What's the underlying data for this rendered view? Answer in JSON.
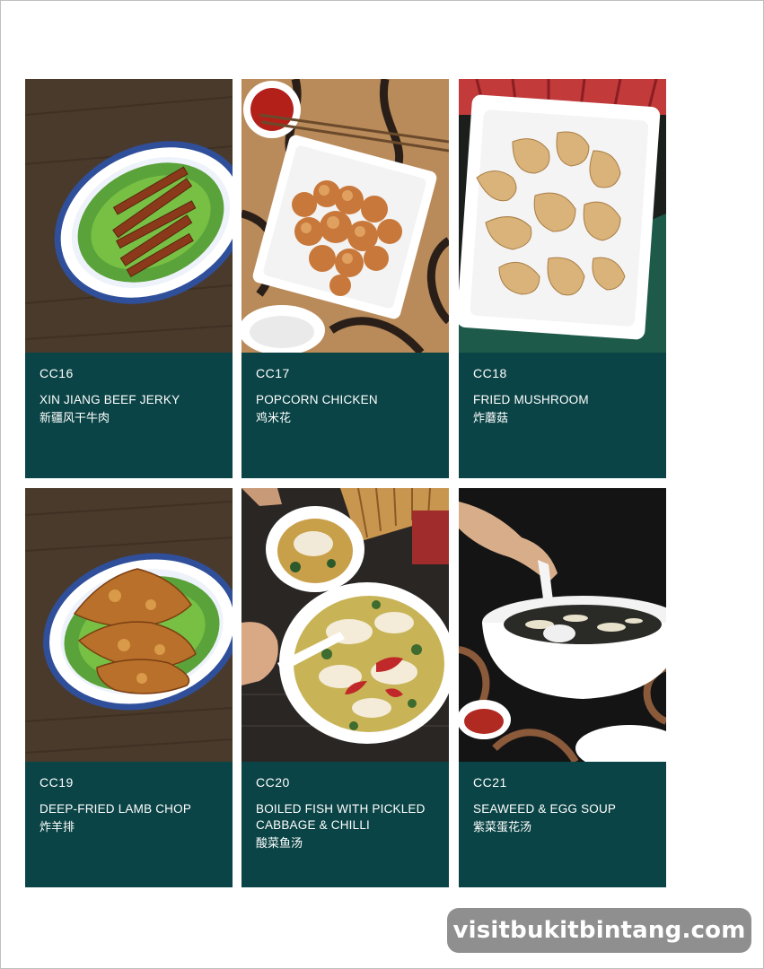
{
  "menu": {
    "items": [
      {
        "code": "CC16",
        "name": "XIN JIANG BEEF JERKY",
        "name_cn": "新疆风干牛肉",
        "image": "beef-jerky-photo"
      },
      {
        "code": "CC17",
        "name": "POPCORN CHICKEN",
        "name_cn": "鸡米花",
        "image": "popcorn-chicken-photo"
      },
      {
        "code": "CC18",
        "name": "FRIED MUSHROOM",
        "name_cn": "炸蘑菇",
        "image": "fried-mushroom-photo"
      },
      {
        "code": "CC19",
        "name": "DEEP-FRIED LAMB CHOP",
        "name_cn": "炸羊排",
        "image": "lamb-chop-photo"
      },
      {
        "code": "CC20",
        "name": "BOILED FISH WITH PICKLED CABBAGE & CHILLI",
        "name_cn": "酸菜鱼汤",
        "image": "boiled-fish-photo"
      },
      {
        "code": "CC21",
        "name": "SEAWEED & EGG SOUP",
        "name_cn": "紫菜蛋花汤",
        "image": "seaweed-soup-photo"
      }
    ]
  },
  "watermark": {
    "text": "visitbukitbintang.com"
  },
  "colors": {
    "card_bg": "#0b4446",
    "watermark_bg": "#8f8f8f",
    "text": "#ffffff"
  }
}
